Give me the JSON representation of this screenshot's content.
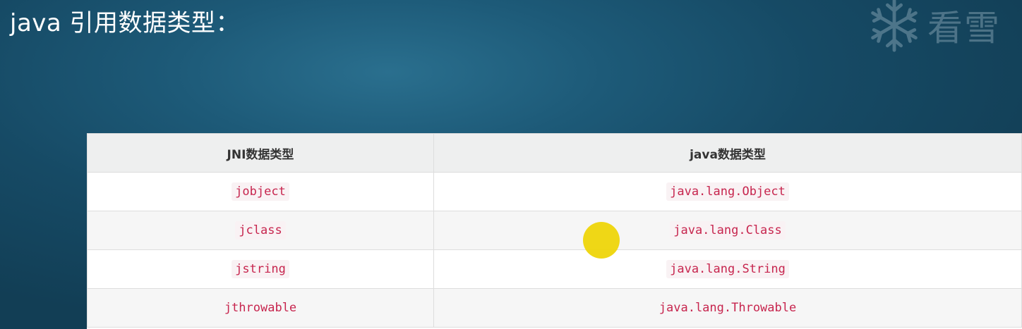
{
  "slide": {
    "title": "java 引用数据类型："
  },
  "watermark": {
    "icon": "snowflake-icon",
    "text": "看雪"
  },
  "table": {
    "headers": [
      "JNI数据类型",
      "java数据类型"
    ],
    "rows": [
      [
        "jobject",
        "java.lang.Object"
      ],
      [
        "jclass",
        "java.lang.Class"
      ],
      [
        "jstring",
        "java.lang.String"
      ],
      [
        "jthrowable",
        "java.lang.Throwable"
      ]
    ]
  },
  "cursor": {
    "color": "#eed50a"
  }
}
